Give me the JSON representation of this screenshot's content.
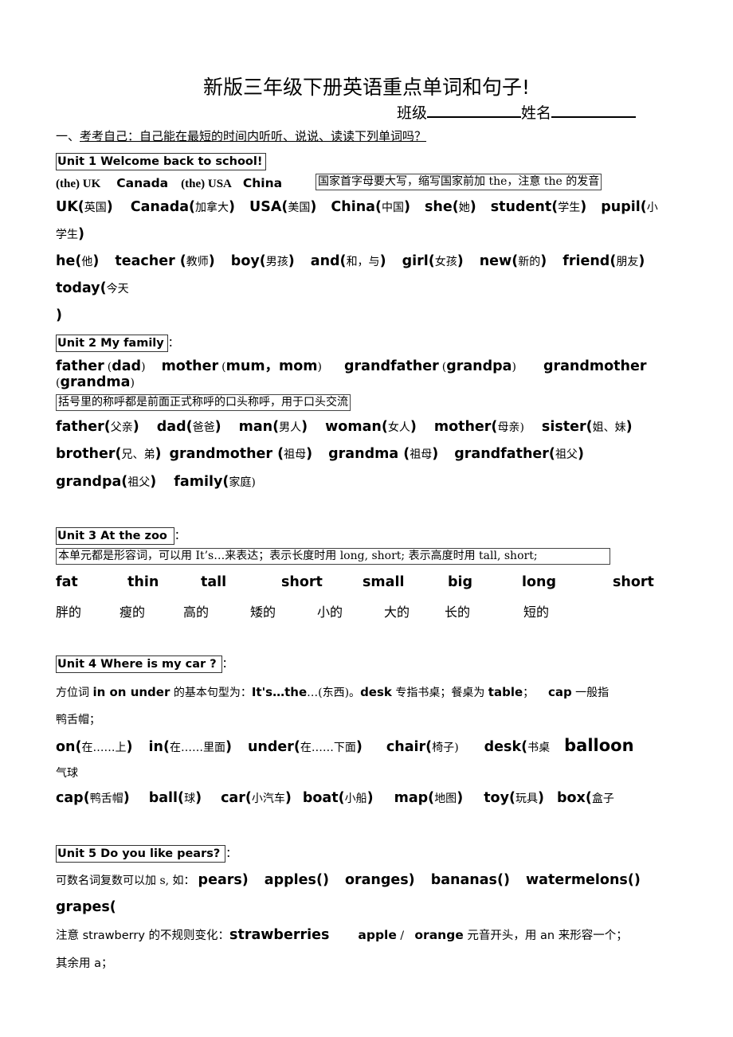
{
  "header": {
    "title": "新版三年级下册英语重点单词和句子!",
    "class_label": "班级",
    "name_label": "姓名"
  },
  "section1": {
    "prefix": "一、",
    "text": "考考自己：自己能在最短的时间内听听、说说、读读下列单词吗？"
  },
  "unit1": {
    "heading": "Unit 1 Welcome back to school!",
    "countries": [
      {
        "text": "(the) UK",
        "style": "serif"
      },
      {
        "text": "Canada",
        "style": "bold"
      },
      {
        "text": "(the) USA",
        "style": "serif"
      },
      {
        "text": "China",
        "style": "bold"
      }
    ],
    "note": "国家首字母要大写，缩写国家前加 the，注意 the 的发音",
    "words_line1": [
      {
        "en": "UK(",
        "cn": "英国",
        "close": ")"
      },
      {
        "en": "Canada(",
        "cn": "加拿大",
        "close": ")"
      },
      {
        "en": "USA(",
        "cn": "美国",
        "close": ")"
      },
      {
        "en": "China(",
        "cn": "中国",
        "close": ")"
      },
      {
        "en": "she(",
        "cn": "她",
        "close": ")"
      },
      {
        "en": "student(",
        "cn": "学生",
        "close": ")"
      },
      {
        "en": "pupil(",
        "cn": "小",
        "close": ""
      }
    ],
    "words_line2": {
      "cn": "学生",
      "close": ")"
    },
    "words_line3": [
      {
        "en": "he(",
        "cn": "他",
        "close": ")"
      },
      {
        "en": "teacher (",
        "cn": "教师",
        "close": ")"
      },
      {
        "en": "boy(",
        "cn": "男孩",
        "close": ")"
      },
      {
        "en": "and(",
        "cn": "和，与",
        "close": ")"
      },
      {
        "en": "girl(",
        "cn": "女孩",
        "close": ")"
      },
      {
        "en": "new(",
        "cn": "新的",
        "close": ")"
      },
      {
        "en": "friend(",
        "cn": "朋友",
        "close": ")"
      }
    ],
    "words_line4": {
      "en": "today(",
      "cn": "今天"
    },
    "words_line5": ")"
  },
  "unit2": {
    "heading": "Unit 2 My family",
    "heading_suffix": "：",
    "pairs": [
      {
        "en": "father",
        "alt": "dad"
      },
      {
        "en": "mother",
        "alt": "mum，mom"
      },
      {
        "en": "grandfather",
        "alt": "grandpa"
      },
      {
        "en": "grandmother",
        "alt": ""
      }
    ],
    "pairs_line2": "grandma",
    "note": "括号里的称呼都是前面正式称呼的口头称呼，用于口头交流",
    "words_line1": [
      {
        "en": "father(",
        "cn": "父亲",
        "close": ")"
      },
      {
        "en": "dad(",
        "cn": "爸爸",
        "close": ")"
      },
      {
        "en": "man(",
        "cn": "男人",
        "close": ")"
      },
      {
        "en": "woman(",
        "cn": "女人",
        "close": ")"
      },
      {
        "en": "mother(",
        "cn": "母亲",
        "close": ")"
      },
      {
        "en": "sister(",
        "cn": "姐、妹",
        "close": ")"
      }
    ],
    "words_line2": [
      {
        "en": "brother(",
        "cn": "兄、弟",
        "close": ")"
      },
      {
        "en": "grandmother (",
        "cn": "祖母",
        "close": ")"
      },
      {
        "en": "grandma (",
        "cn": "祖母",
        "close": ")"
      },
      {
        "en": "grandfather(",
        "cn": "祖父",
        "close": ")"
      }
    ],
    "words_line3": [
      {
        "en": "grandpa(",
        "cn": "祖父",
        "close": ")"
      },
      {
        "en": "family(",
        "cn": "家庭",
        "close": ")"
      }
    ]
  },
  "unit3": {
    "heading": "Unit 3   At the zoo",
    "heading_suffix": "：",
    "note": "本单元都是形容词，可以用 It’s…来表达；表示长度时用 long, short; 表示高度时用 tall, short;",
    "words_en": [
      "fat",
      "thin",
      "tall",
      "short",
      "small",
      "big",
      "long",
      "short"
    ],
    "words_cn": [
      "胖的",
      "瘦的",
      "高的",
      "矮的",
      "小的",
      "大的",
      "长的",
      "短的"
    ]
  },
  "unit4": {
    "heading": "Unit 4  Where is my car ?",
    "heading_suffix": "：",
    "explain_line1": [
      {
        "t": "方位词 ",
        "b": false
      },
      {
        "t": "in on under",
        "b": true
      },
      {
        "t": " 的基本句型为：",
        "b": false
      },
      {
        "t": "It's…the",
        "b": true
      },
      {
        "t": "…(东西)。",
        "b": false
      },
      {
        "t": "desk",
        "b": true
      },
      {
        "t": " 专指书桌；餐桌为 ",
        "b": false
      },
      {
        "t": "table",
        "b": true
      },
      {
        "t": "；    ",
        "b": false
      },
      {
        "t": "cap",
        "b": true
      },
      {
        "t": " 一般指",
        "b": false
      }
    ],
    "explain_line2": "鸭舌帽；",
    "words_line1": [
      {
        "en": "on(",
        "cn": "在……上",
        "close": ")"
      },
      {
        "en": "in(",
        "cn": "在……里面",
        "close": ")"
      },
      {
        "en": "under(",
        "cn": "在……下面",
        "close": ")"
      },
      {
        "en": "chair(",
        "cn": "椅子",
        "close": ")"
      },
      {
        "en": "desk(",
        "cn": "书桌",
        "close": ""
      }
    ],
    "balloon": "balloon",
    "balloon_cn": "气球",
    "words_line3": [
      {
        "en": "cap(",
        "cn": "鸭舌帽",
        "close": ")"
      },
      {
        "en": "ball(",
        "cn": "球",
        "close": ")"
      },
      {
        "en": "car(",
        "cn": "小汽车",
        "close": ")"
      },
      {
        "en": "boat(",
        "cn": "小船",
        "close": ")"
      },
      {
        "en": "map(",
        "cn": "地图",
        "close": ")"
      },
      {
        "en": "toy(",
        "cn": "玩具",
        "close": ")"
      },
      {
        "en": "box(",
        "cn": "盒子",
        "close": ""
      }
    ]
  },
  "unit5": {
    "heading": "Unit 5 Do you like pears?",
    "heading_suffix": "：",
    "plural_intro": "可数名词复数可以加 s, 如：",
    "plurals": [
      "pears)",
      "apples()",
      "oranges)",
      "bananas()",
      "watermelons()"
    ],
    "plurals_line2": "grapes(",
    "strawberry_note": "注意 strawberry 的不规则变化：",
    "strawberries": "strawberries",
    "apple": "apple",
    "slash": " /   ",
    "orange": "orange",
    "an_note": " 元音开头，用 an 来形容一个；",
    "rest_note": "其余用 a；"
  }
}
